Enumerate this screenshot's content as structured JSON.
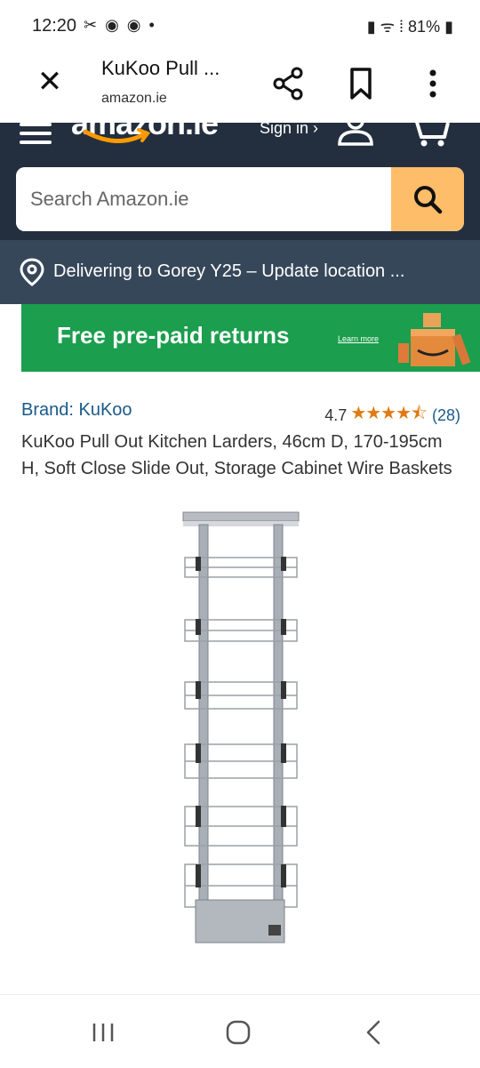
{
  "status_bar": {
    "time": "12:20",
    "left_icons": "✂ ◉ ◉ •",
    "battery": "81%"
  },
  "custom_tab": {
    "title": "KuKoo Pull ...",
    "url": "amazon.ie"
  },
  "amazon_header": {
    "logo_text": "amazon.ie",
    "signin_label": "Sign in ›",
    "search_placeholder": "Search Amazon.ie"
  },
  "delivery": {
    "text": "Delivering to Gorey Y25 – Update location ..."
  },
  "promo_banner": {
    "text": "Free pre-paid returns",
    "link": "Learn more"
  },
  "product": {
    "brand": "Brand: KuKoo",
    "rating": "4.7",
    "stars_text": "★★★★⯪",
    "rating_count": "(28)",
    "stars_value": 4.7,
    "title": "KuKoo Pull Out Kitchen Larders, 46cm D, 170-195cm H, Soft Close Slide Out, Storage Cabinet Wire Baskets"
  },
  "colors": {
    "amazon_dark": "#232f3e",
    "amazon_mid": "#37475a",
    "search_button": "#febd69",
    "banner_green": "#1b9e4d",
    "star_orange": "#e07a12",
    "link_blue": "#1a5a8a"
  },
  "icons": [
    "close-icon",
    "share-icon",
    "bookmark-icon",
    "more-vert-icon",
    "hamburger-icon",
    "account-icon",
    "cart-icon",
    "search-icon",
    "location-pin-icon",
    "recents-icon",
    "home-icon",
    "back-icon"
  ]
}
